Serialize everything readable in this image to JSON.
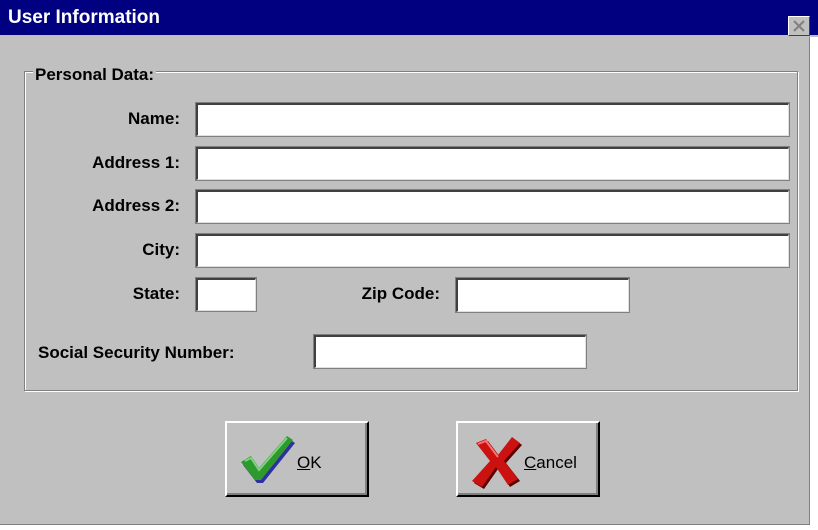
{
  "window": {
    "title": "User Information",
    "title_bar_color": "#000080",
    "close_icon": "close-icon"
  },
  "group": {
    "legend": "Personal Data:"
  },
  "fields": {
    "name_label": "Name:",
    "name_value": "",
    "address1_label": "Address 1:",
    "address1_value": "",
    "address2_label": "Address 2:",
    "address2_value": "",
    "city_label": "City:",
    "city_value": "",
    "state_label": "State:",
    "state_value": "",
    "zip_label": "Zip Code:",
    "zip_value": "",
    "ssn_label": "Social Security Number:",
    "ssn_value": ""
  },
  "buttons": {
    "ok": {
      "label": "OK",
      "mnemonic": "O",
      "rest": "K",
      "icon": "checkmark-icon",
      "icon_color": "#2e9a2e"
    },
    "cancel": {
      "label": "Cancel",
      "mnemonic": "C",
      "rest": "ancel",
      "icon": "x-mark-icon",
      "icon_color": "#cc1111"
    }
  }
}
